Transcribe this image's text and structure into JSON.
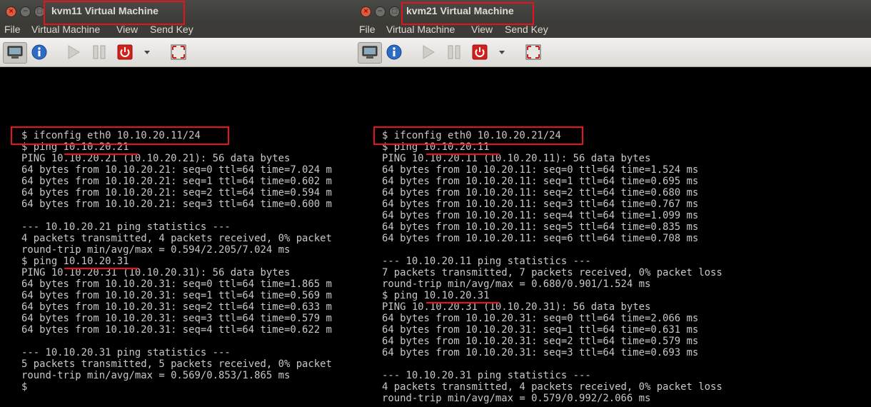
{
  "windows": [
    {
      "title": "kvm11 Virtual Machine",
      "menu": [
        "File",
        "Virtual Machine",
        "View",
        "Send Key"
      ],
      "terminal_lines": [
        "$ ifconfig eth0 10.10.20.11/24",
        "$ ping 10.10.20.21",
        "PING 10.10.20.21 (10.10.20.21): 56 data bytes",
        "64 bytes from 10.10.20.21: seq=0 ttl=64 time=7.024 m",
        "64 bytes from 10.10.20.21: seq=1 ttl=64 time=0.602 m",
        "64 bytes from 10.10.20.21: seq=2 ttl=64 time=0.594 m",
        "64 bytes from 10.10.20.21: seq=3 ttl=64 time=0.600 m",
        "",
        "--- 10.10.20.21 ping statistics ---",
        "4 packets transmitted, 4 packets received, 0% packet",
        "round-trip min/avg/max = 0.594/2.205/7.024 ms",
        "$ ping 10.10.20.31",
        "PING 10.10.20.31 (10.10.20.31): 56 data bytes",
        "64 bytes from 10.10.20.31: seq=0 ttl=64 time=1.865 m",
        "64 bytes from 10.10.20.31: seq=1 ttl=64 time=0.569 m",
        "64 bytes from 10.10.20.31: seq=2 ttl=64 time=0.633 m",
        "64 bytes from 10.10.20.31: seq=3 ttl=64 time=0.579 m",
        "64 bytes from 10.10.20.31: seq=4 ttl=64 time=0.622 m",
        "",
        "--- 10.10.20.31 ping statistics ---",
        "5 packets transmitted, 5 packets received, 0% packet",
        "round-trip min/avg/max = 0.569/0.853/1.865 ms",
        "$"
      ]
    },
    {
      "title": "kvm21 Virtual Machine",
      "menu": [
        "File",
        "Virtual Machine",
        "View",
        "Send Key"
      ],
      "terminal_lines": [
        "$ ifconfig eth0 10.10.20.21/24",
        "$ ping 10.10.20.11",
        "PING 10.10.20.11 (10.10.20.11): 56 data bytes",
        "64 bytes from 10.10.20.11: seq=0 ttl=64 time=1.524 ms",
        "64 bytes from 10.10.20.11: seq=1 ttl=64 time=0.695 ms",
        "64 bytes from 10.10.20.11: seq=2 ttl=64 time=0.680 ms",
        "64 bytes from 10.10.20.11: seq=3 ttl=64 time=0.767 ms",
        "64 bytes from 10.10.20.11: seq=4 ttl=64 time=1.099 ms",
        "64 bytes from 10.10.20.11: seq=5 ttl=64 time=0.835 ms",
        "64 bytes from 10.10.20.11: seq=6 ttl=64 time=0.708 ms",
        "",
        "--- 10.10.20.11 ping statistics ---",
        "7 packets transmitted, 7 packets received, 0% packet loss",
        "round-trip min/avg/max = 0.680/0.901/1.524 ms",
        "$ ping 10.10.20.31",
        "PING 10.10.20.31 (10.10.20.31): 56 data bytes",
        "64 bytes from 10.10.20.31: seq=0 ttl=64 time=2.066 ms",
        "64 bytes from 10.10.20.31: seq=1 ttl=64 time=0.631 ms",
        "64 bytes from 10.10.20.31: seq=2 ttl=64 time=0.579 ms",
        "64 bytes from 10.10.20.31: seq=3 ttl=64 time=0.693 ms",
        "",
        "--- 10.10.20.31 ping statistics ---",
        "4 packets transmitted, 4 packets received, 0% packet loss",
        "round-trip min/avg/max = 0.579/0.992/2.066 ms"
      ]
    }
  ],
  "window_controls": {
    "close": "×",
    "minimize": "−",
    "maximize": "□"
  },
  "icons": [
    "console-icon",
    "details-info-icon",
    "run-icon",
    "pause-icon",
    "shutdown-icon",
    "dropdown-icon",
    "fullscreen-icon"
  ],
  "colors": {
    "highlight": "#e8121c",
    "terminal_bg": "#000000",
    "terminal_fg": "#c8c8c8",
    "menubar_bg": "#3c3b37"
  }
}
